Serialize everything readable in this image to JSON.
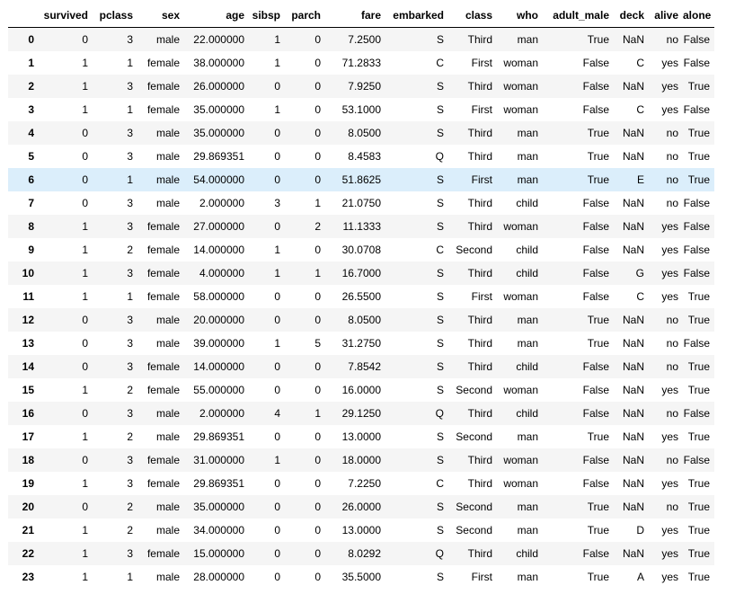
{
  "table": {
    "index_header": "",
    "columns": [
      "survived",
      "pclass",
      "sex",
      "age",
      "sibsp",
      "parch",
      "fare",
      "embarked",
      "class",
      "who",
      "adult_male",
      "deck",
      "alive",
      "alone"
    ],
    "rows": [
      {
        "index": "0",
        "cells": [
          "0",
          "3",
          "male",
          "22.000000",
          "1",
          "0",
          "7.2500",
          "S",
          "Third",
          "man",
          "True",
          "NaN",
          "no",
          "False"
        ]
      },
      {
        "index": "1",
        "cells": [
          "1",
          "1",
          "female",
          "38.000000",
          "1",
          "0",
          "71.2833",
          "C",
          "First",
          "woman",
          "False",
          "C",
          "yes",
          "False"
        ]
      },
      {
        "index": "2",
        "cells": [
          "1",
          "3",
          "female",
          "26.000000",
          "0",
          "0",
          "7.9250",
          "S",
          "Third",
          "woman",
          "False",
          "NaN",
          "yes",
          "True"
        ]
      },
      {
        "index": "3",
        "cells": [
          "1",
          "1",
          "female",
          "35.000000",
          "1",
          "0",
          "53.1000",
          "S",
          "First",
          "woman",
          "False",
          "C",
          "yes",
          "False"
        ]
      },
      {
        "index": "4",
        "cells": [
          "0",
          "3",
          "male",
          "35.000000",
          "0",
          "0",
          "8.0500",
          "S",
          "Third",
          "man",
          "True",
          "NaN",
          "no",
          "True"
        ]
      },
      {
        "index": "5",
        "cells": [
          "0",
          "3",
          "male",
          "29.869351",
          "0",
          "0",
          "8.4583",
          "Q",
          "Third",
          "man",
          "True",
          "NaN",
          "no",
          "True"
        ]
      },
      {
        "index": "6",
        "cells": [
          "0",
          "1",
          "male",
          "54.000000",
          "0",
          "0",
          "51.8625",
          "S",
          "First",
          "man",
          "True",
          "E",
          "no",
          "True"
        ]
      },
      {
        "index": "7",
        "cells": [
          "0",
          "3",
          "male",
          "2.000000",
          "3",
          "1",
          "21.0750",
          "S",
          "Third",
          "child",
          "False",
          "NaN",
          "no",
          "False"
        ]
      },
      {
        "index": "8",
        "cells": [
          "1",
          "3",
          "female",
          "27.000000",
          "0",
          "2",
          "11.1333",
          "S",
          "Third",
          "woman",
          "False",
          "NaN",
          "yes",
          "False"
        ]
      },
      {
        "index": "9",
        "cells": [
          "1",
          "2",
          "female",
          "14.000000",
          "1",
          "0",
          "30.0708",
          "C",
          "Second",
          "child",
          "False",
          "NaN",
          "yes",
          "False"
        ]
      },
      {
        "index": "10",
        "cells": [
          "1",
          "3",
          "female",
          "4.000000",
          "1",
          "1",
          "16.7000",
          "S",
          "Third",
          "child",
          "False",
          "G",
          "yes",
          "False"
        ]
      },
      {
        "index": "11",
        "cells": [
          "1",
          "1",
          "female",
          "58.000000",
          "0",
          "0",
          "26.5500",
          "S",
          "First",
          "woman",
          "False",
          "C",
          "yes",
          "True"
        ]
      },
      {
        "index": "12",
        "cells": [
          "0",
          "3",
          "male",
          "20.000000",
          "0",
          "0",
          "8.0500",
          "S",
          "Third",
          "man",
          "True",
          "NaN",
          "no",
          "True"
        ]
      },
      {
        "index": "13",
        "cells": [
          "0",
          "3",
          "male",
          "39.000000",
          "1",
          "5",
          "31.2750",
          "S",
          "Third",
          "man",
          "True",
          "NaN",
          "no",
          "False"
        ]
      },
      {
        "index": "14",
        "cells": [
          "0",
          "3",
          "female",
          "14.000000",
          "0",
          "0",
          "7.8542",
          "S",
          "Third",
          "child",
          "False",
          "NaN",
          "no",
          "True"
        ]
      },
      {
        "index": "15",
        "cells": [
          "1",
          "2",
          "female",
          "55.000000",
          "0",
          "0",
          "16.0000",
          "S",
          "Second",
          "woman",
          "False",
          "NaN",
          "yes",
          "True"
        ]
      },
      {
        "index": "16",
        "cells": [
          "0",
          "3",
          "male",
          "2.000000",
          "4",
          "1",
          "29.1250",
          "Q",
          "Third",
          "child",
          "False",
          "NaN",
          "no",
          "False"
        ]
      },
      {
        "index": "17",
        "cells": [
          "1",
          "2",
          "male",
          "29.869351",
          "0",
          "0",
          "13.0000",
          "S",
          "Second",
          "man",
          "True",
          "NaN",
          "yes",
          "True"
        ]
      },
      {
        "index": "18",
        "cells": [
          "0",
          "3",
          "female",
          "31.000000",
          "1",
          "0",
          "18.0000",
          "S",
          "Third",
          "woman",
          "False",
          "NaN",
          "no",
          "False"
        ]
      },
      {
        "index": "19",
        "cells": [
          "1",
          "3",
          "female",
          "29.869351",
          "0",
          "0",
          "7.2250",
          "C",
          "Third",
          "woman",
          "False",
          "NaN",
          "yes",
          "True"
        ]
      },
      {
        "index": "20",
        "cells": [
          "0",
          "2",
          "male",
          "35.000000",
          "0",
          "0",
          "26.0000",
          "S",
          "Second",
          "man",
          "True",
          "NaN",
          "no",
          "True"
        ]
      },
      {
        "index": "21",
        "cells": [
          "1",
          "2",
          "male",
          "34.000000",
          "0",
          "0",
          "13.0000",
          "S",
          "Second",
          "man",
          "True",
          "D",
          "yes",
          "True"
        ]
      },
      {
        "index": "22",
        "cells": [
          "1",
          "3",
          "female",
          "15.000000",
          "0",
          "0",
          "8.0292",
          "Q",
          "Third",
          "child",
          "False",
          "NaN",
          "yes",
          "True"
        ]
      },
      {
        "index": "23",
        "cells": [
          "1",
          "1",
          "male",
          "28.000000",
          "0",
          "0",
          "35.5000",
          "S",
          "First",
          "man",
          "True",
          "A",
          "yes",
          "True"
        ]
      }
    ],
    "hovered_row_index": "6"
  }
}
